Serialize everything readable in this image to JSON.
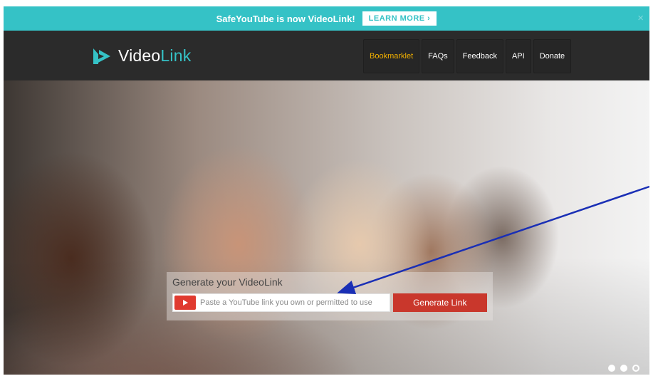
{
  "announcement": {
    "text": "SafeYouTube is now VideoLink!",
    "learn_more": "LEARN MORE ›",
    "close": "×"
  },
  "brand": {
    "name_part1": "Video",
    "name_part2": "Link",
    "accent": "#35c2c6"
  },
  "nav": {
    "items": [
      {
        "label": "Bookmarklet"
      },
      {
        "label": "FAQs"
      },
      {
        "label": "Feedback"
      },
      {
        "label": "API"
      },
      {
        "label": "Donate"
      }
    ]
  },
  "generator": {
    "title": "Generate your VideoLink",
    "placeholder": "Paste a YouTube link you own or permitted to use",
    "button": "Generate Link"
  },
  "colors": {
    "banner": "#35c2c6",
    "navbar": "#2b2b2b",
    "active_nav": "#f3b100",
    "button": "#c9372c",
    "annotation_arrow": "#1a2fb5"
  }
}
